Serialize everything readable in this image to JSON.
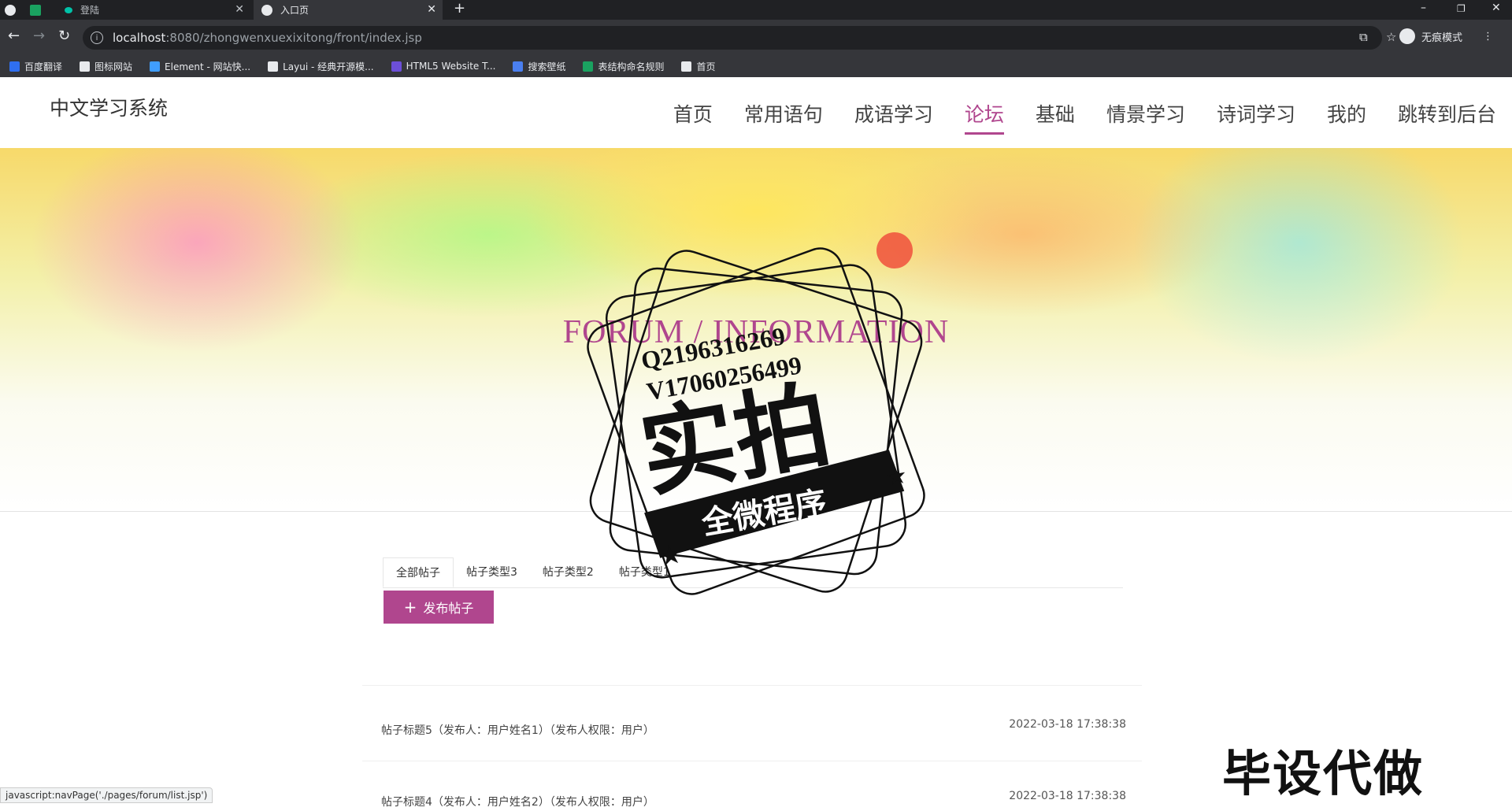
{
  "browser": {
    "tabs": [
      {
        "label": ""
      },
      {
        "label": ""
      },
      {
        "label": "登陆"
      },
      {
        "label": "入口页"
      }
    ],
    "url_host": "localhost",
    "url_rest": ":8080/zhongwenxuexixitong/front/index.jsp",
    "incognito_label": "无痕模式",
    "bookmarks": [
      {
        "label": "百度翻译",
        "color": "#2f6ff0"
      },
      {
        "label": "图标网站",
        "color": "#e8eaed"
      },
      {
        "label": "Element - 网站快...",
        "color": "#409eff"
      },
      {
        "label": "Layui - 经典开源模...",
        "color": "#e8eaed"
      },
      {
        "label": "HTML5 Website T...",
        "color": "#6c4fd8"
      },
      {
        "label": "搜索壁纸",
        "color": "#4a7ff0"
      },
      {
        "label": "表结构命名规则",
        "color": "#1aa260"
      },
      {
        "label": "首页",
        "color": "#e8eaed"
      }
    ]
  },
  "site": {
    "brand": "中文学习系统",
    "nav": [
      {
        "label": "首页"
      },
      {
        "label": "常用语句"
      },
      {
        "label": "成语学习"
      },
      {
        "label": "论坛"
      },
      {
        "label": "基础"
      },
      {
        "label": "情景学习"
      },
      {
        "label": "诗词学习"
      },
      {
        "label": "我的"
      },
      {
        "label": "跳转到后台"
      }
    ],
    "accent": "#b0468e"
  },
  "banner": {
    "title": "FORUM / INFORMATION"
  },
  "forum": {
    "tabs": [
      {
        "label": "全部帖子"
      },
      {
        "label": "帖子类型3"
      },
      {
        "label": "帖子类型2"
      },
      {
        "label": "帖子类型1"
      }
    ],
    "publish_label": "发布帖子",
    "posts": [
      {
        "title": "帖子标题5（发布人：用户姓名1）（发布人权限：用户）",
        "time": "2022-03-18 17:38:38"
      },
      {
        "title": "帖子标题4（发布人：用户姓名2）（发布人权限：用户）",
        "time": "2022-03-18 17:38:38"
      }
    ]
  },
  "watermark": {
    "line1": "Q2196316269",
    "line2": "V17060256499",
    "big": "实拍",
    "ribbon": "全微程序",
    "corner": "毕设代做"
  },
  "statusbar": "javascript:navPage('./pages/forum/list.jsp')"
}
